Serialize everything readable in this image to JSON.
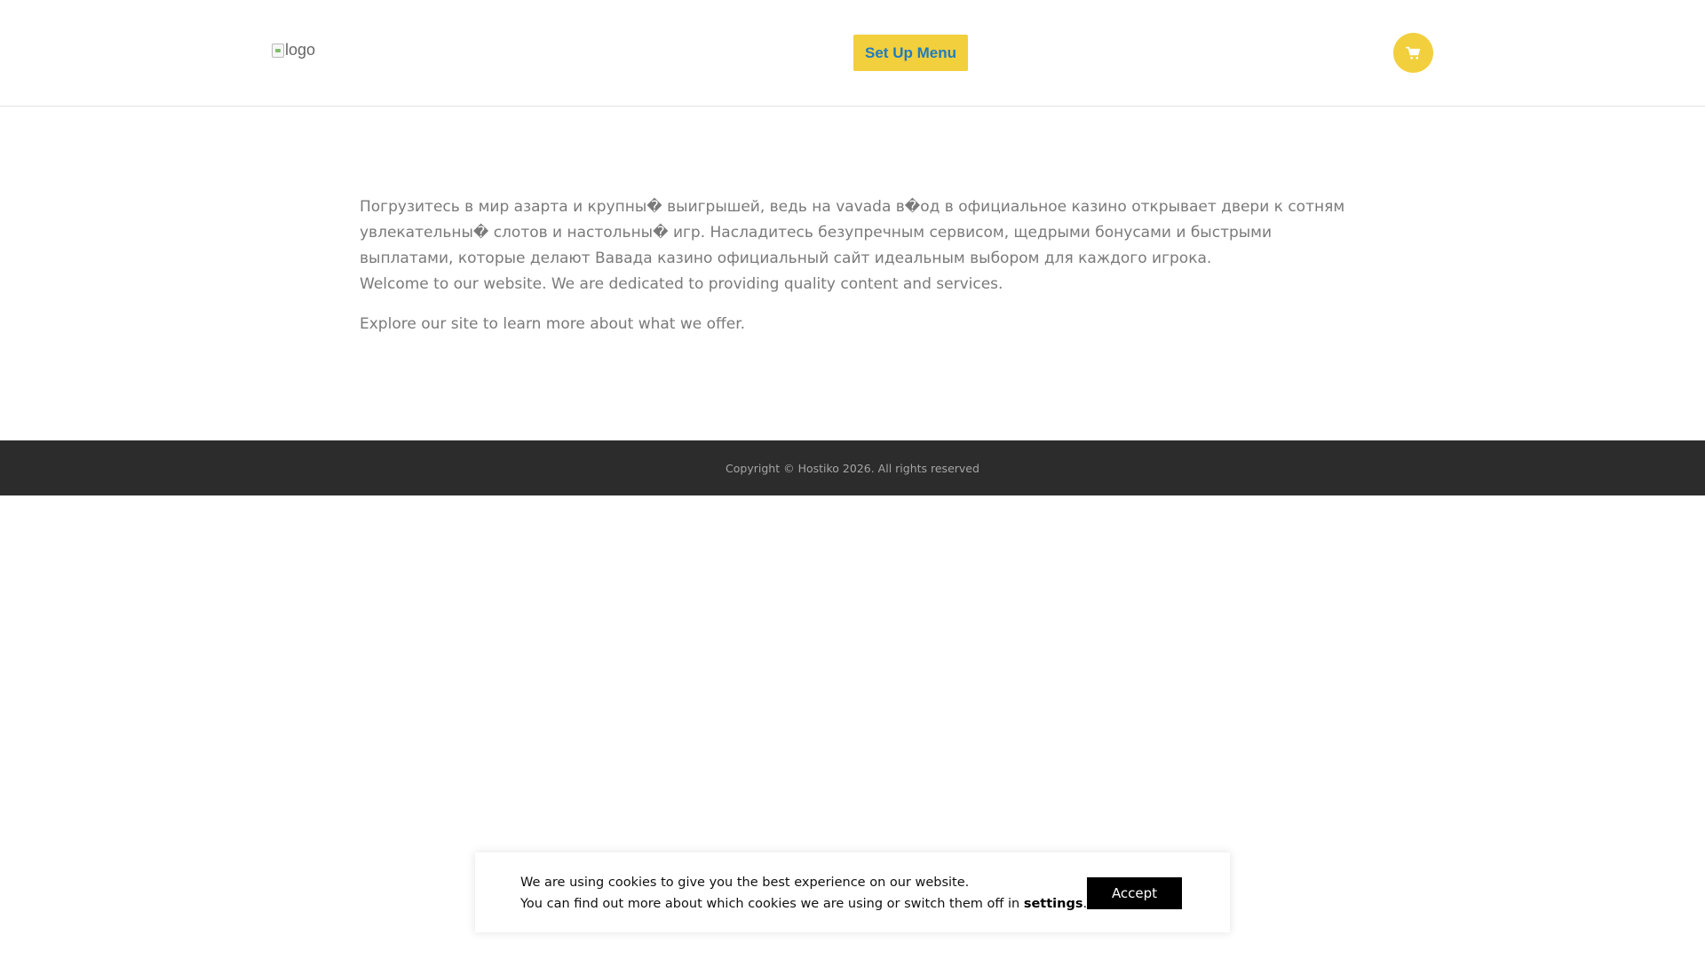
{
  "header": {
    "logo_alt": "logo",
    "menu_button_label": "Set Up Menu",
    "cart_icon": "cart-icon",
    "accent_color": "#f2cf3c",
    "menu_text_color": "#1f7cc2"
  },
  "main": {
    "paragraph_1": "Погрузитесь в мир азарта и крупны� выигрышей, ведь на vavada в�од в официальное казино открывает двери к сотням увлекательны� слотов и настольны� игр. Насладитесь безупречным сервисом, щедрыми бонусами и быстрыми выплатами, которые делают Вавада казино официальный сайт идеальным выбором для каждого игрока.",
    "paragraph_2": "Welcome to our website. We are dedicated to providing quality content and services.",
    "paragraph_3": "Explore our site to learn more about what we offer."
  },
  "footer": {
    "copyright": "Copyright © Hostiko 2026. All rights reserved",
    "background_color": "#2c2c2c"
  },
  "cookie_banner": {
    "line_1": "We are using cookies to give you the best experience on our website.",
    "line_2_prefix": "You can find out more about which cookies we are using or switch them off in ",
    "settings_link": "settings",
    "line_2_suffix": ".",
    "accept_label": "Accept"
  }
}
